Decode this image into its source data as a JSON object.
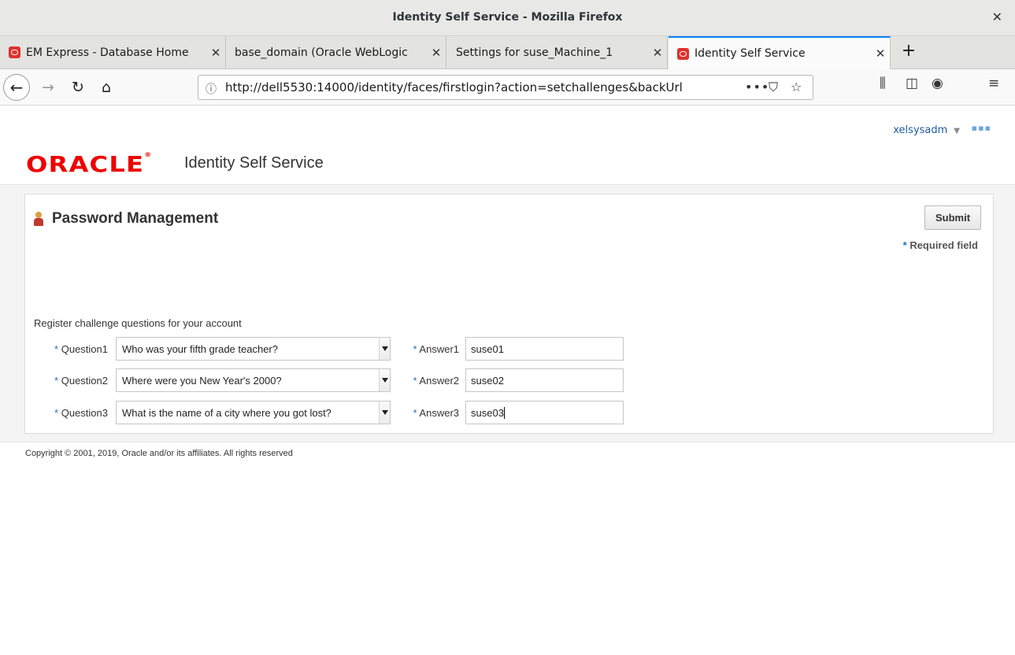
{
  "window": {
    "title": "Identity Self Service - Mozilla Firefox"
  },
  "tabs": [
    {
      "label": "EM Express - Database Home",
      "active": false
    },
    {
      "label": "base_domain (Oracle WebLogic",
      "active": false
    },
    {
      "label": "Settings for suse_Machine_1",
      "active": false
    },
    {
      "label": "Identity Self Service",
      "active": true
    }
  ],
  "navbar": {
    "url": "http://dell5530:14000/identity/faces/firstlogin?action=setchallenges&backUrl"
  },
  "header": {
    "user": "xelsysadm",
    "logo": "ORACLE",
    "app_name": "Identity Self Service"
  },
  "panel": {
    "title": "Password Management",
    "submit_label": "Submit",
    "required_note": "Required field",
    "intro": "Register challenge questions for your account",
    "rows": [
      {
        "q_label": "Question1",
        "question": "Who was your fifth grade teacher?",
        "a_label": "Answer1",
        "answer": "suse01"
      },
      {
        "q_label": "Question2",
        "question": "Where were you New Year's 2000?",
        "a_label": "Answer2",
        "answer": "suse02"
      },
      {
        "q_label": "Question3",
        "question": "What is the name of a city where you got lost?",
        "a_label": "Answer3",
        "answer": "suse03"
      }
    ]
  },
  "footer": {
    "copyright": "Copyright © 2001, 2019, Oracle and/or its affiliates. All rights reserved"
  },
  "colors": {
    "oracle_red": "#ee0000",
    "link_blue": "#1f5a9e",
    "tab_accent": "#0a84ff"
  }
}
